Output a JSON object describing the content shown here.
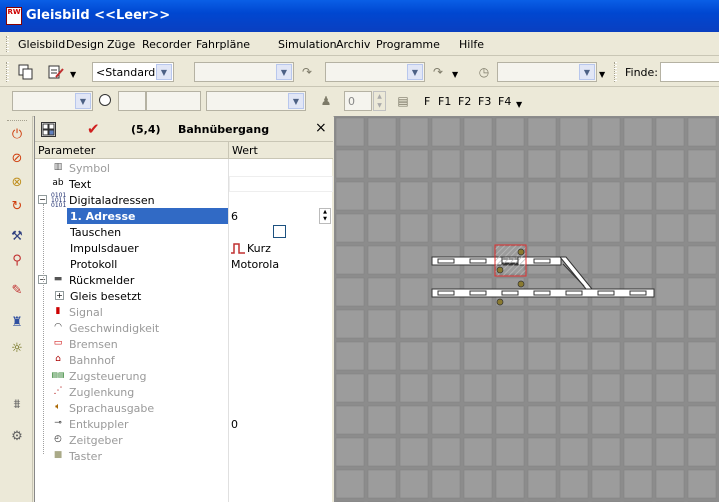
{
  "window": {
    "title": "Gleisbild <<Leer>>",
    "icon_text": "RW"
  },
  "menu": {
    "items": [
      "Gleisbild",
      "Design",
      "Züge",
      "Recorder",
      "Fahrpläne",
      "Simulation",
      "Archiv",
      "Programme",
      "Hilfe"
    ]
  },
  "toolbar1": {
    "style_combo": "<Standard>",
    "find_label": "Finde:"
  },
  "toolbar2": {
    "number_value": "0",
    "fkeys": [
      "F",
      "F1",
      "F2",
      "F3",
      "F4"
    ]
  },
  "panel": {
    "position": "(5,4)",
    "title": "Bahnübergang",
    "close": "×",
    "col_param": "Parameter",
    "col_value": "Wert",
    "rows": [
      {
        "label": "Symbol",
        "value": ""
      },
      {
        "label": "Text",
        "value": ""
      },
      {
        "label": "Digitaladressen",
        "value": ""
      },
      {
        "label": "1. Adresse",
        "value": "6"
      },
      {
        "label": "Tauschen",
        "value": ""
      },
      {
        "label": "Impulsdauer",
        "value": "Kurz"
      },
      {
        "label": "Protokoll",
        "value": "Motorola"
      },
      {
        "label": "Rückmelder",
        "value": ""
      },
      {
        "label": "Gleis besetzt",
        "value": ""
      },
      {
        "label": "Signal",
        "value": ""
      },
      {
        "label": "Geschwindigkeit",
        "value": ""
      },
      {
        "label": "Bremsen",
        "value": ""
      },
      {
        "label": "Bahnhof",
        "value": ""
      },
      {
        "label": "Zugsteuerung",
        "value": ""
      },
      {
        "label": "Zuglenkung",
        "value": ""
      },
      {
        "label": "Sprachausgabe",
        "value": ""
      },
      {
        "label": "Entkuppler",
        "value": "0"
      },
      {
        "label": "Zeitgeber",
        "value": ""
      },
      {
        "label": "Taster",
        "value": ""
      }
    ]
  },
  "colors": {
    "selection": "#316ac5",
    "titlebar": "#0a5fe6",
    "canvas_bg": "#8c8c8c",
    "track_cursor": "#e03030"
  }
}
